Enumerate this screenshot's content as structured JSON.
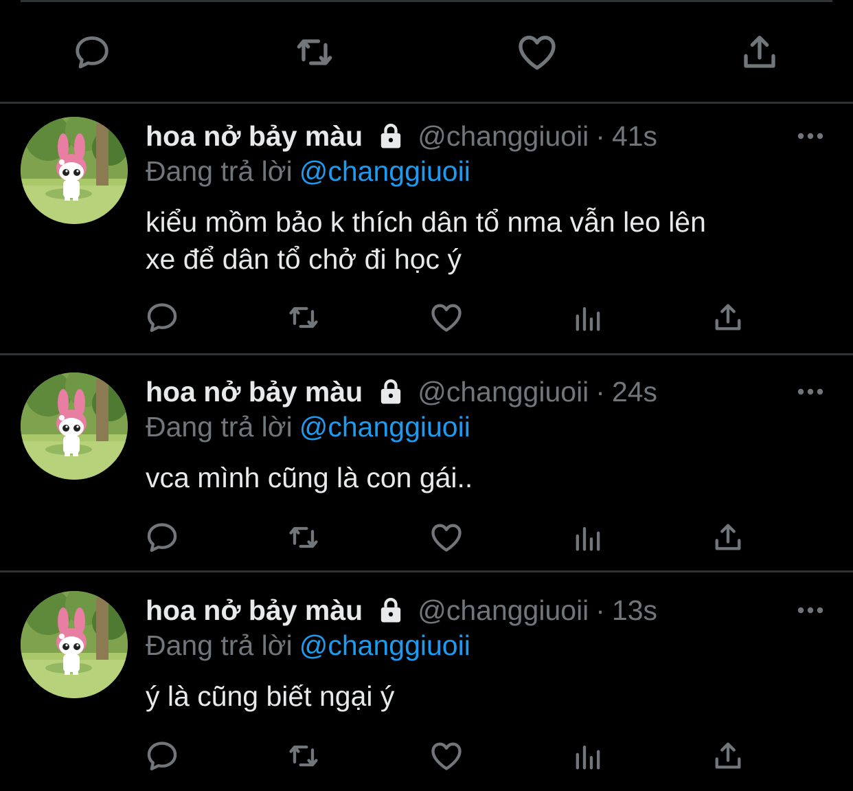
{
  "tweets": [
    {
      "name": "hoa nở bảy màu",
      "handle": "@changgiuoii",
      "separator": "·",
      "time": "41s",
      "reply_label": "Đang trả lời",
      "reply_handle": "@changgiuoii",
      "lines": [
        "kiểu mồm bảo k thích dân tổ nma vẫn leo lên",
        "xe để dân tổ chở đi học ý"
      ]
    },
    {
      "name": "hoa nở bảy màu",
      "handle": "@changgiuoii",
      "separator": "·",
      "time": "24s",
      "reply_label": "Đang trả lời",
      "reply_handle": "@changgiuoii",
      "lines": [
        "vca mình cũng là con gái.."
      ]
    },
    {
      "name": "hoa nở bảy màu",
      "handle": "@changgiuoii",
      "separator": "·",
      "time": "13s",
      "reply_label": "Đang trả lời",
      "reply_handle": "@changgiuoii",
      "lines": [
        "ý là cũng biết ngại ý"
      ]
    }
  ],
  "icons": {
    "top_actions": [
      "reply-icon",
      "retweet-icon",
      "like-icon",
      "share-icon"
    ],
    "tweet_actions": [
      "reply-icon",
      "retweet-icon",
      "like-icon",
      "analytics-icon",
      "share-icon"
    ],
    "header": [
      "lock-icon",
      "more-icon"
    ]
  },
  "colors": {
    "background": "#000000",
    "primary_text": "#e7e9ea",
    "secondary_text": "#71767b",
    "accent": "#1d9bf0",
    "divider": "#2f3336"
  }
}
